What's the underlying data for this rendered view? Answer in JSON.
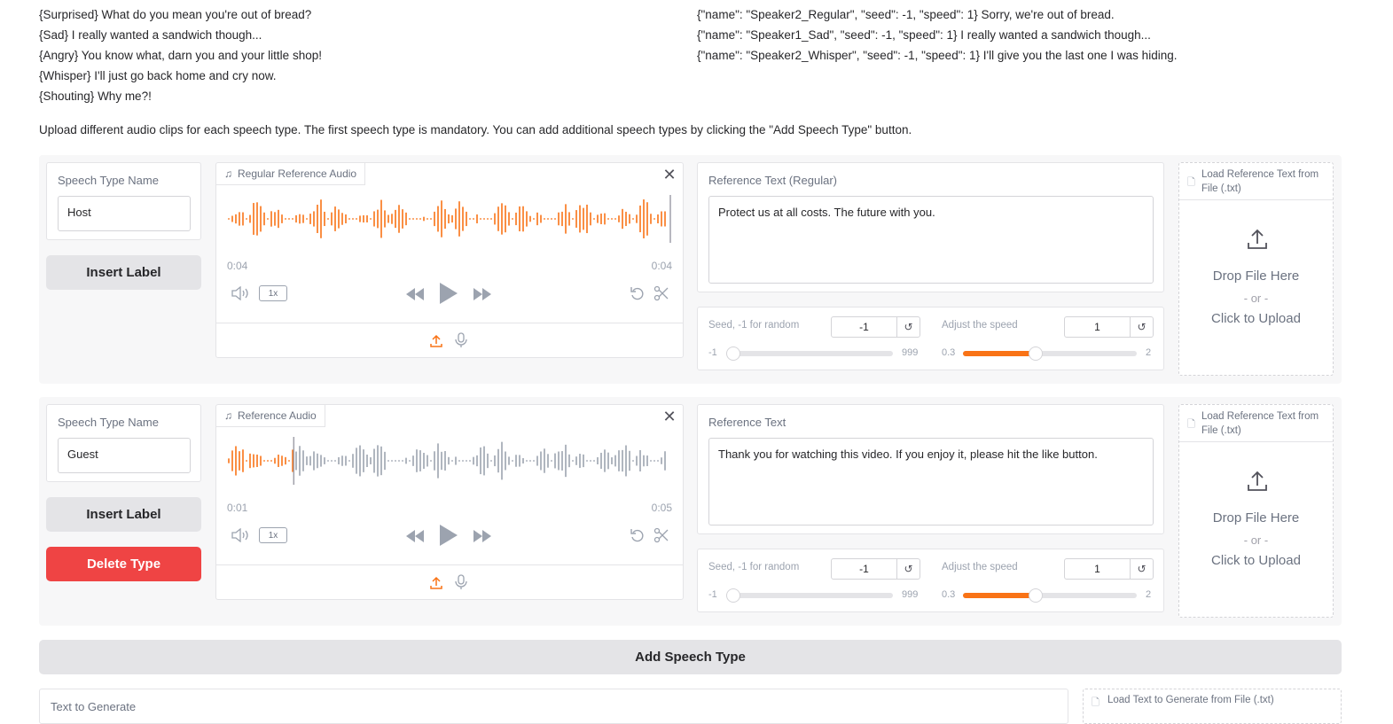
{
  "examples_left": [
    "{Surprised} What do you mean you're out of bread?",
    "{Sad} I really wanted a sandwich though...",
    "{Angry} You know what, darn you and your little shop!",
    "{Whisper} I'll just go back home and cry now.",
    "{Shouting} Why me?!"
  ],
  "examples_right": [
    "{\"name\": \"Speaker2_Regular\", \"seed\": -1, \"speed\": 1} Sorry, we're out of bread.",
    "{\"name\": \"Speaker1_Sad\", \"seed\": -1, \"speed\": 1} I really wanted a sandwich though...",
    "{\"name\": \"Speaker2_Whisper\", \"seed\": -1, \"speed\": 1} I'll give you the last one I was hiding."
  ],
  "intro": "Upload different audio clips for each speech type. The first speech type is mandatory. You can add additional speech types by clicking the \"Add Speech Type\" button.",
  "speech_types": [
    {
      "name_label": "Speech Type Name",
      "name_value": "Host",
      "insert_label": "Insert Label",
      "audio_label": "Regular Reference Audio",
      "time_current": "0:04",
      "time_total": "0:04",
      "playback_speed": "1x",
      "ref_text_label": "Reference Text (Regular)",
      "ref_text_value": "Protect us at all costs. The future with you.",
      "seed_label": "Seed, -1 for random",
      "seed_value": "-1",
      "seed_min": "-1",
      "seed_max": "999",
      "speed_label": "Adjust the speed",
      "speed_value": "1",
      "speed_min": "0.3",
      "speed_max": "2",
      "load_label": "Load Reference Text from File (.txt)",
      "drop_text": "Drop File Here",
      "or_text": "- or -",
      "upload_text": "Click to Upload"
    },
    {
      "name_label": "Speech Type Name",
      "name_value": "Guest",
      "insert_label": "Insert Label",
      "delete_label": "Delete Type",
      "audio_label": "Reference Audio",
      "time_current": "0:01",
      "time_total": "0:05",
      "playback_speed": "1x",
      "ref_text_label": "Reference Text",
      "ref_text_value": "Thank you for watching this video. If you enjoy it, please hit the like button.",
      "seed_label": "Seed, -1 for random",
      "seed_value": "-1",
      "seed_min": "-1",
      "seed_max": "999",
      "speed_label": "Adjust the speed",
      "speed_value": "1",
      "speed_min": "0.3",
      "speed_max": "2",
      "load_label": "Load Reference Text from File (.txt)",
      "drop_text": "Drop File Here",
      "or_text": "- or -",
      "upload_text": "Click to Upload"
    }
  ],
  "add_speech_type": "Add Speech Type",
  "text_to_generate_label": "Text to Generate",
  "load_text_label": "Load Text to Generate from File (.txt)",
  "colors": {
    "accent": "#f97316",
    "danger": "#ef4444",
    "wave_inactive": "#9ca3af"
  },
  "playback_progress": [
    1.0,
    0.15
  ]
}
